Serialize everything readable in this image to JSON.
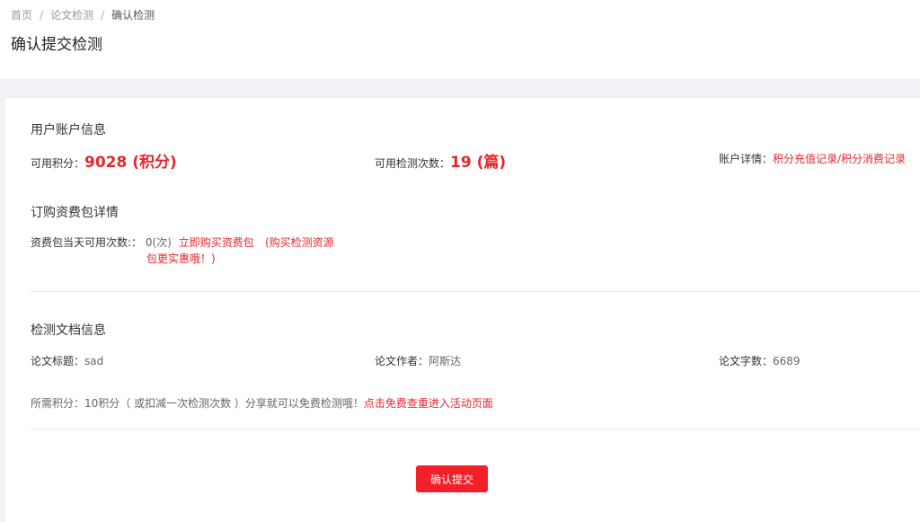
{
  "breadcrumb": {
    "items": [
      "首页",
      "论文检测",
      "确认检测"
    ],
    "separator": "/"
  },
  "page": {
    "title": "确认提交检测"
  },
  "account": {
    "section_title": "用户账户信息",
    "points_label": "可用积分：",
    "points_value": "9028 (积分)",
    "checks_label": "可用检测次数：",
    "checks_value": "19 (篇)",
    "details_label": "账户详情：",
    "details_link": "积分充值记录/积分消费记录"
  },
  "package": {
    "section_title": "订购资费包详情",
    "daily_label": "资费包当天可用次数:：",
    "daily_value": "0(次)",
    "buy_link": "立即购买资费包",
    "promo_line1": "(购买检测资源",
    "promo_line2": "包更实惠哦！)"
  },
  "document": {
    "section_title": "检测文档信息",
    "title_label": "论文标题：",
    "title_value": "sad",
    "author_label": "论文作者：",
    "author_value": "阿斯达",
    "words_label": "论文字数：",
    "words_value": "6689",
    "cost_text": "所需积分：10积分（ 或扣减一次检测次数 ）分享就可以免费检测哦！",
    "cost_link": "点击免费查重进入活动页面"
  },
  "actions": {
    "submit_label": "确认提交"
  },
  "colors": {
    "accent": "#e8262c",
    "button": "#f1202a"
  }
}
